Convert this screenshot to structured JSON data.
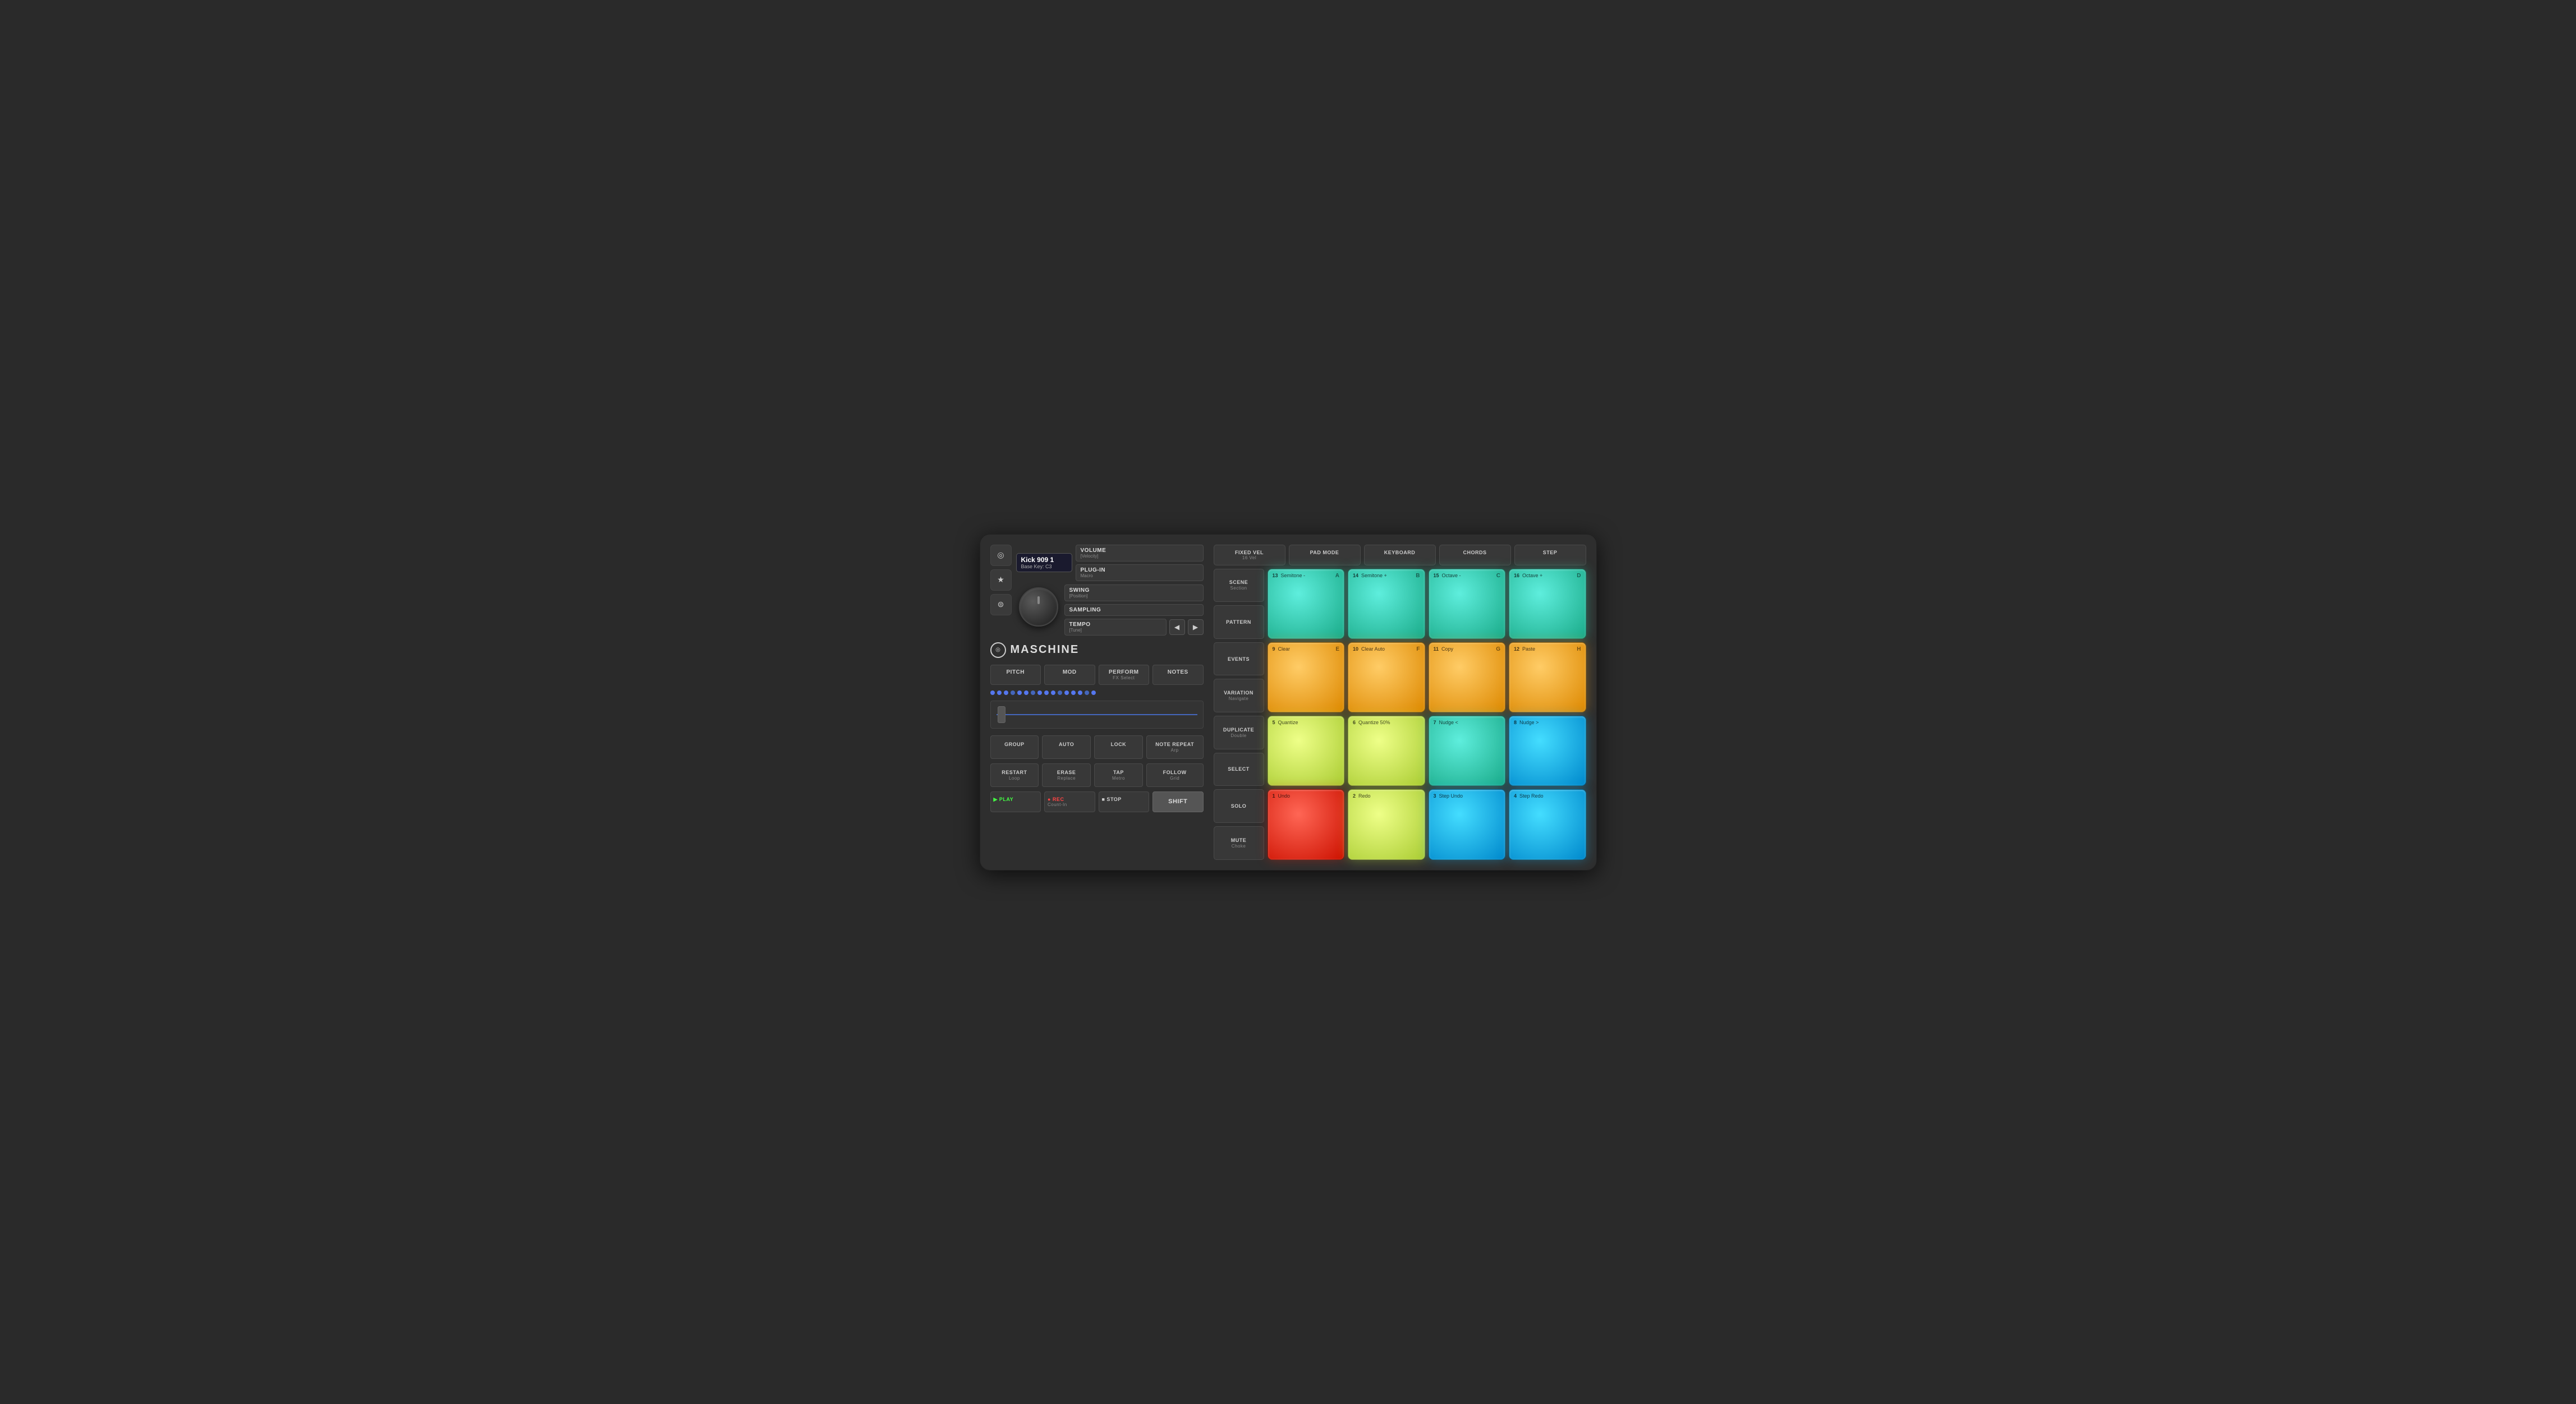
{
  "controller": {
    "name": "MASCHINE"
  },
  "left": {
    "icon_buttons": [
      {
        "name": "circle-icon",
        "symbol": "◎"
      },
      {
        "name": "star-icon",
        "symbol": "★"
      },
      {
        "name": "search-icon",
        "symbol": "⊜"
      }
    ],
    "track": {
      "number": "1",
      "name": "Kick 909 1",
      "sub": "Base Key: C3"
    },
    "params": [
      {
        "main": "VOLUME",
        "sub": "[Velocity]"
      },
      {
        "main": "PLUG-IN",
        "sub": "Macro"
      },
      {
        "main": "SWING",
        "sub": "[Position]"
      },
      {
        "main": "SAMPLING",
        "sub": ""
      },
      {
        "main": "TEMPO",
        "sub": "[Tune]"
      }
    ],
    "functions": [
      {
        "main": "PITCH",
        "sub": ""
      },
      {
        "main": "MOD",
        "sub": ""
      },
      {
        "main": "PERFORM",
        "sub": "FX Select"
      },
      {
        "main": "NOTES",
        "sub": ""
      }
    ],
    "bottom_row1": [
      {
        "main": "GROUP",
        "sub": ""
      },
      {
        "main": "AUTO",
        "sub": ""
      },
      {
        "main": "LOCK",
        "sub": ""
      },
      {
        "main": "NOTE REPEAT",
        "sub": "Arp"
      }
    ],
    "bottom_row2": [
      {
        "main": "RESTART",
        "sub": "Loop"
      },
      {
        "main": "ERASE",
        "sub": "Replace"
      },
      {
        "main": "TAP",
        "sub": "Metro"
      },
      {
        "main": "FOLLOW",
        "sub": "Grid"
      }
    ],
    "transport": [
      {
        "main": "▶ PLAY",
        "sub": "",
        "type": "play"
      },
      {
        "main": "● REC",
        "sub": "Count-In",
        "type": "rec"
      },
      {
        "main": "■ STOP",
        "sub": "",
        "type": "stop"
      },
      {
        "main": "SHIFT",
        "sub": "",
        "type": "shift"
      }
    ]
  },
  "right": {
    "modes": [
      {
        "label": "FIXED VEL",
        "sub": "16 Vel"
      },
      {
        "label": "PAD MODE",
        "sub": ""
      },
      {
        "label": "KEYBOARD",
        "sub": ""
      },
      {
        "label": "CHORDS",
        "sub": ""
      },
      {
        "label": "STEP",
        "sub": ""
      }
    ],
    "pad_labels": [
      {
        "main": "SCENE",
        "sub": "Section"
      },
      {
        "main": "PATTERN",
        "sub": ""
      },
      {
        "main": "EVENTS",
        "sub": ""
      },
      {
        "main": "VARIATION",
        "sub": "Navigate"
      },
      {
        "main": "DUPLICATE",
        "sub": "Double"
      },
      {
        "main": "SELECT",
        "sub": ""
      },
      {
        "main": "SOLO",
        "sub": ""
      },
      {
        "main": "MUTE",
        "sub": "Choke"
      }
    ],
    "pads": [
      {
        "row": 0,
        "col": 0,
        "number": "13",
        "label": "Semitone -",
        "letter": "A",
        "color": "teal"
      },
      {
        "row": 0,
        "col": 1,
        "number": "14",
        "label": "Semitone +",
        "letter": "B",
        "color": "teal"
      },
      {
        "row": 0,
        "col": 2,
        "number": "15",
        "label": "Octave -",
        "letter": "C",
        "color": "teal"
      },
      {
        "row": 0,
        "col": 3,
        "number": "16",
        "label": "Octave +",
        "letter": "D",
        "color": "teal"
      },
      {
        "row": 1,
        "col": 0,
        "number": "9",
        "label": "Clear",
        "letter": "E",
        "color": "orange"
      },
      {
        "row": 1,
        "col": 1,
        "number": "10",
        "label": "Clear Auto",
        "letter": "F",
        "color": "orange"
      },
      {
        "row": 1,
        "col": 2,
        "number": "11",
        "label": "Copy",
        "letter": "G",
        "color": "orange"
      },
      {
        "row": 1,
        "col": 3,
        "number": "12",
        "label": "Paste",
        "letter": "H",
        "color": "orange"
      },
      {
        "row": 2,
        "col": 0,
        "number": "5",
        "label": "Quantize",
        "letter": "",
        "color": "yellow"
      },
      {
        "row": 2,
        "col": 1,
        "number": "6",
        "label": "Quantize 50%",
        "letter": "",
        "color": "yellow"
      },
      {
        "row": 2,
        "col": 2,
        "number": "7",
        "label": "Nudge <",
        "letter": "",
        "color": "teal"
      },
      {
        "row": 2,
        "col": 3,
        "number": "8",
        "label": "Nudge >",
        "letter": "",
        "color": "cyan"
      },
      {
        "row": 3,
        "col": 0,
        "number": "1",
        "label": "Undo",
        "letter": "",
        "color": "red"
      },
      {
        "row": 3,
        "col": 1,
        "number": "2",
        "label": "Redo",
        "letter": "",
        "color": "yellow"
      },
      {
        "row": 3,
        "col": 2,
        "number": "3",
        "label": "Step Undo",
        "letter": "",
        "color": "cyan"
      },
      {
        "row": 3,
        "col": 3,
        "number": "4",
        "label": "Step Redo",
        "letter": "",
        "color": "cyan"
      }
    ]
  }
}
